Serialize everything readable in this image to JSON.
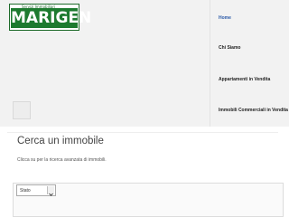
{
  "logo": {
    "tagline": "Servizi Immobiliari",
    "wordmark": "MARIGEN",
    "colors": {
      "brand": "#1d7a2f",
      "border": "#1f6b2b"
    }
  },
  "nav": {
    "items": [
      {
        "label": "Home",
        "active": true
      },
      {
        "label": "Chi Siamo",
        "active": false
      },
      {
        "label": "Appartamenti in Vendita",
        "active": false
      },
      {
        "label": "Immobili Commerciali in Vendita",
        "active": false
      }
    ],
    "active_color": "#2b5aa8"
  },
  "main": {
    "title": "Cerca un immobile",
    "intro": "Clicca su  per la ricerca avanzata di immobili.",
    "select": {
      "selected": "Stato",
      "icon": "chevron-down-icon"
    }
  }
}
